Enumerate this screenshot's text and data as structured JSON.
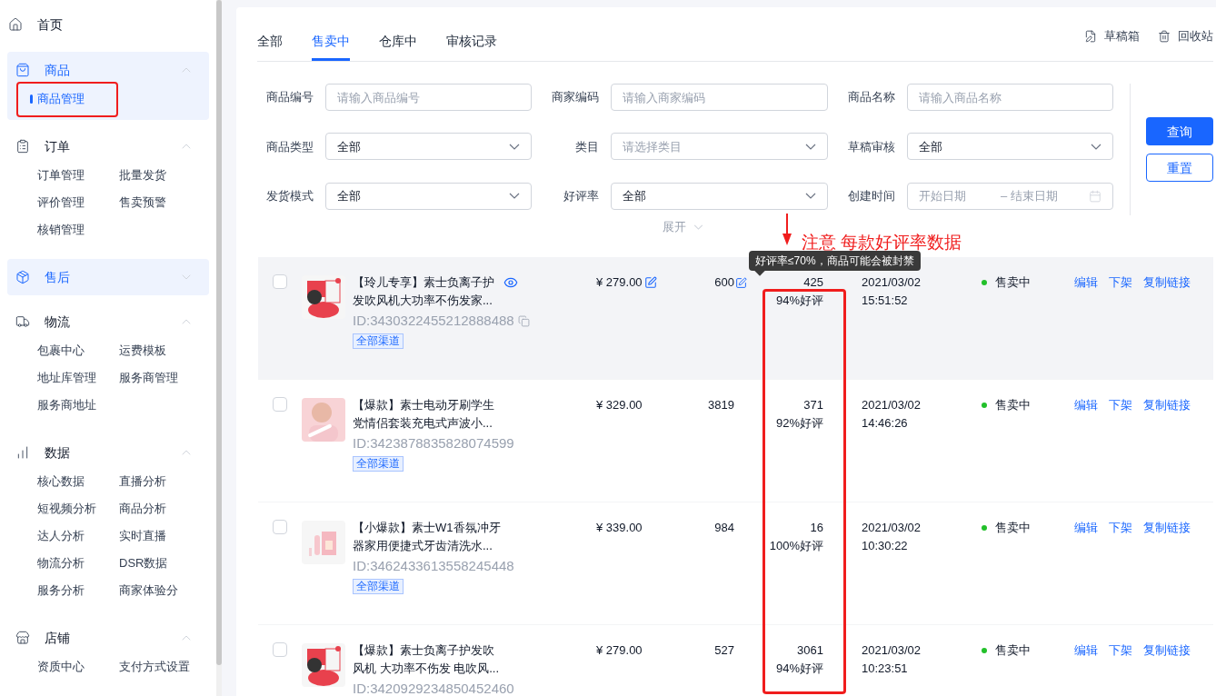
{
  "sidebar": {
    "items": [
      {
        "kind": "link",
        "label": "首页"
      },
      {
        "kind": "group",
        "label": "商品",
        "active": true,
        "expanded": true,
        "children": [
          {
            "label": "商品管理",
            "selected": true
          }
        ]
      },
      {
        "kind": "group",
        "label": "订单",
        "active": false,
        "expanded": true,
        "children": [
          {
            "label": "订单管理",
            "selected": false
          },
          {
            "label": "批量发货",
            "selected": false
          },
          {
            "label": "评价管理",
            "selected": false
          },
          {
            "label": "售卖预警",
            "selected": false
          },
          {
            "label": "核销管理",
            "selected": false
          }
        ]
      },
      {
        "kind": "group",
        "label": "售后",
        "active": true,
        "expanded": false
      },
      {
        "kind": "group",
        "label": "物流",
        "active": false,
        "expanded": true,
        "children": [
          {
            "label": "包裹中心",
            "selected": false
          },
          {
            "label": "运费模板",
            "selected": false
          },
          {
            "label": "地址库管理",
            "selected": false
          },
          {
            "label": "服务商管理",
            "selected": false
          },
          {
            "label": "服务商地址",
            "selected": false
          }
        ]
      },
      {
        "kind": "group",
        "label": "数据",
        "active": false,
        "expanded": true,
        "children": [
          {
            "label": "核心数据",
            "selected": false
          },
          {
            "label": "直播分析",
            "selected": false
          },
          {
            "label": "短视频分析",
            "selected": false
          },
          {
            "label": "商品分析",
            "selected": false
          },
          {
            "label": "达人分析",
            "selected": false
          },
          {
            "label": "实时直播",
            "selected": false
          },
          {
            "label": "物流分析",
            "selected": false
          },
          {
            "label": "DSR数据",
            "selected": false
          },
          {
            "label": "服务分析",
            "selected": false
          },
          {
            "label": "商家体验分",
            "selected": false
          }
        ]
      },
      {
        "kind": "group",
        "label": "店铺",
        "active": false,
        "expanded": true,
        "children": [
          {
            "label": "资质中心",
            "selected": false
          },
          {
            "label": "支付方式设置",
            "selected": false
          }
        ]
      }
    ]
  },
  "tabs": [
    {
      "label": "全部",
      "selected": false
    },
    {
      "label": "售卖中",
      "selected": true
    },
    {
      "label": "仓库中",
      "selected": false
    },
    {
      "label": "审核记录",
      "selected": false
    }
  ],
  "toolbar": [
    {
      "label": "草稿箱"
    },
    {
      "label": "回收站"
    }
  ],
  "filters": [
    {
      "kind": "input",
      "label": "商品编号",
      "placeholder": "请输入商品编号"
    },
    {
      "kind": "input",
      "label": "商家编码",
      "placeholder": "请输入商家编码"
    },
    {
      "kind": "input",
      "label": "商品名称",
      "placeholder": "请输入商品名称"
    },
    {
      "kind": "select",
      "label": "商品类型",
      "value": "全部"
    },
    {
      "kind": "select",
      "label": "类目",
      "placeholder": "请选择类目"
    },
    {
      "kind": "select",
      "label": "草稿审核",
      "value": "全部"
    },
    {
      "kind": "select",
      "label": "发货模式",
      "value": "全部"
    },
    {
      "kind": "select",
      "label": "好评率",
      "value": "全部"
    },
    {
      "kind": "daterange",
      "label": "创建时间",
      "placeholder": "开始日期",
      "separator": "–",
      "placeholder_end": "结束日期"
    }
  ],
  "buttons": [
    {
      "kind": "primary",
      "label": "查询"
    },
    {
      "kind": "outline",
      "label": "重置"
    }
  ],
  "expand_toggle": "展开",
  "annotation": "注意 每款好评率数据",
  "tooltip": "好评率≤70%，商品可能会被封禁",
  "rows": [
    {
      "hovered": true,
      "title_lines": [
        "【玲儿专享】素士负离子护",
        "发吹风机大功率不伤发家..."
      ],
      "id": "ID:3430322455212888488",
      "tag": "全部渠道",
      "price": "¥ 279.00",
      "stock": "600",
      "reviews": "425",
      "rating": "94%好评",
      "date": "2021/03/02",
      "time": "15:51:52",
      "status": "售卖中",
      "color": "#22c02a",
      "actions": [
        "编辑",
        "下架",
        "复制链接"
      ]
    },
    {
      "hovered": false,
      "title_lines": [
        "【爆款】素士电动牙刷学生",
        "党情侣套装充电式声波小..."
      ],
      "id": "ID:3423878835828074599",
      "tag": "全部渠道",
      "price": "¥ 329.00",
      "stock": "3819",
      "reviews": "371",
      "rating": "92%好评",
      "date": "2021/03/02",
      "time": "14:46:26",
      "status": "售卖中",
      "color": "#22c02a",
      "actions": [
        "编辑",
        "下架",
        "复制链接"
      ]
    },
    {
      "hovered": false,
      "title_lines": [
        "【小爆款】素士W1香氛冲牙",
        "器家用便捷式牙齿清洗水..."
      ],
      "id": "ID:3462433613558245448",
      "tag": "全部渠道",
      "price": "¥ 339.00",
      "stock": "984",
      "reviews": "16",
      "rating": "100%好评",
      "date": "2021/03/02",
      "time": "10:30:22",
      "status": "售卖中",
      "color": "#22c02a",
      "actions": [
        "编辑",
        "下架",
        "复制链接"
      ]
    },
    {
      "hovered": false,
      "title_lines": [
        "【爆款】素士负离子护发吹",
        "风机 大功率不伤发 电吹风..."
      ],
      "id": "ID:3420929234850452460",
      "price": "¥ 279.00",
      "stock": "527",
      "reviews": "3061",
      "rating": "94%好评",
      "date": "2021/03/02",
      "time": "10:23:51",
      "status": "售卖中",
      "color": "#22c02a",
      "actions": [
        "编辑",
        "下架",
        "复制链接"
      ]
    }
  ]
}
